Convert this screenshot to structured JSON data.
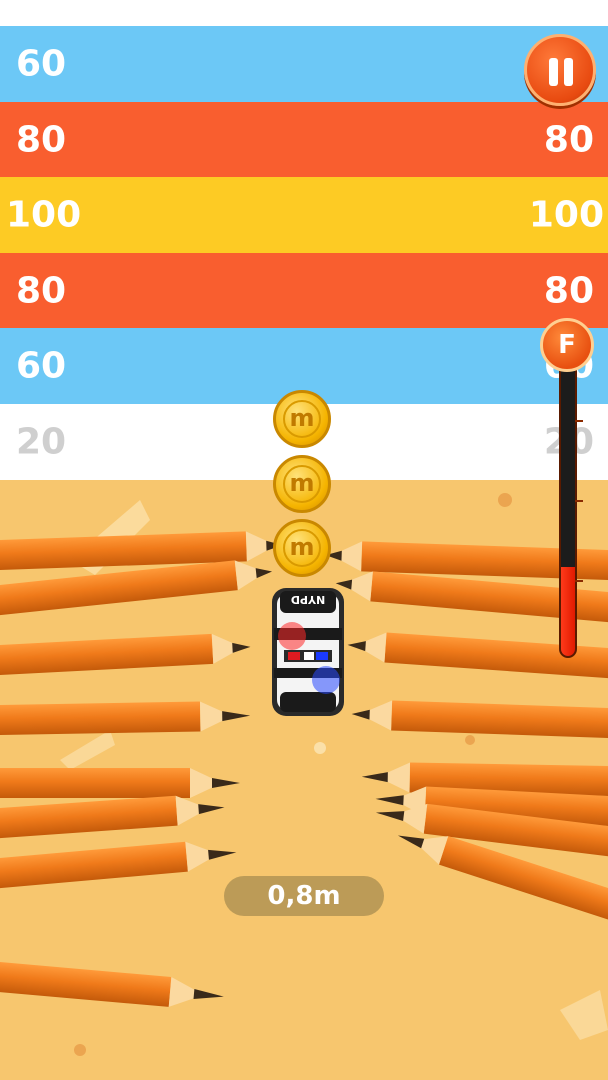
{
  "score_bands": [
    {
      "left_label": "60",
      "right_label": "60",
      "color": "#6cc8f6",
      "style": "blue"
    },
    {
      "left_label": "80",
      "right_label": "80",
      "color": "#f95e2f",
      "style": "red"
    },
    {
      "left_label": "100",
      "right_label": "100",
      "color": "#fdcb24",
      "style": "yellow"
    },
    {
      "left_label": "80",
      "right_label": "80",
      "color": "#f95e2f",
      "style": "red"
    },
    {
      "left_label": "60",
      "right_label": "60",
      "color": "#6cc8f6",
      "style": "blue"
    },
    {
      "left_label": "20",
      "right_label": "20",
      "color": "#ffffff",
      "style": "white"
    }
  ],
  "top_band": {
    "left_label": "20",
    "right_label": "20",
    "color": "#ffffff"
  },
  "pause_button": {
    "icon": "pause-icon",
    "color": "#e84a10"
  },
  "fuel_gauge": {
    "label": "F",
    "level": 0.3,
    "icon": "fuel-icon"
  },
  "coins": {
    "count": 3,
    "symbol": "m"
  },
  "car": {
    "roof_text": "NYPD",
    "icon": "police-car-icon"
  },
  "distance": {
    "value": "0,8m"
  },
  "colors": {
    "ground": "#f7c66e",
    "pencil": "#f07a1a"
  }
}
